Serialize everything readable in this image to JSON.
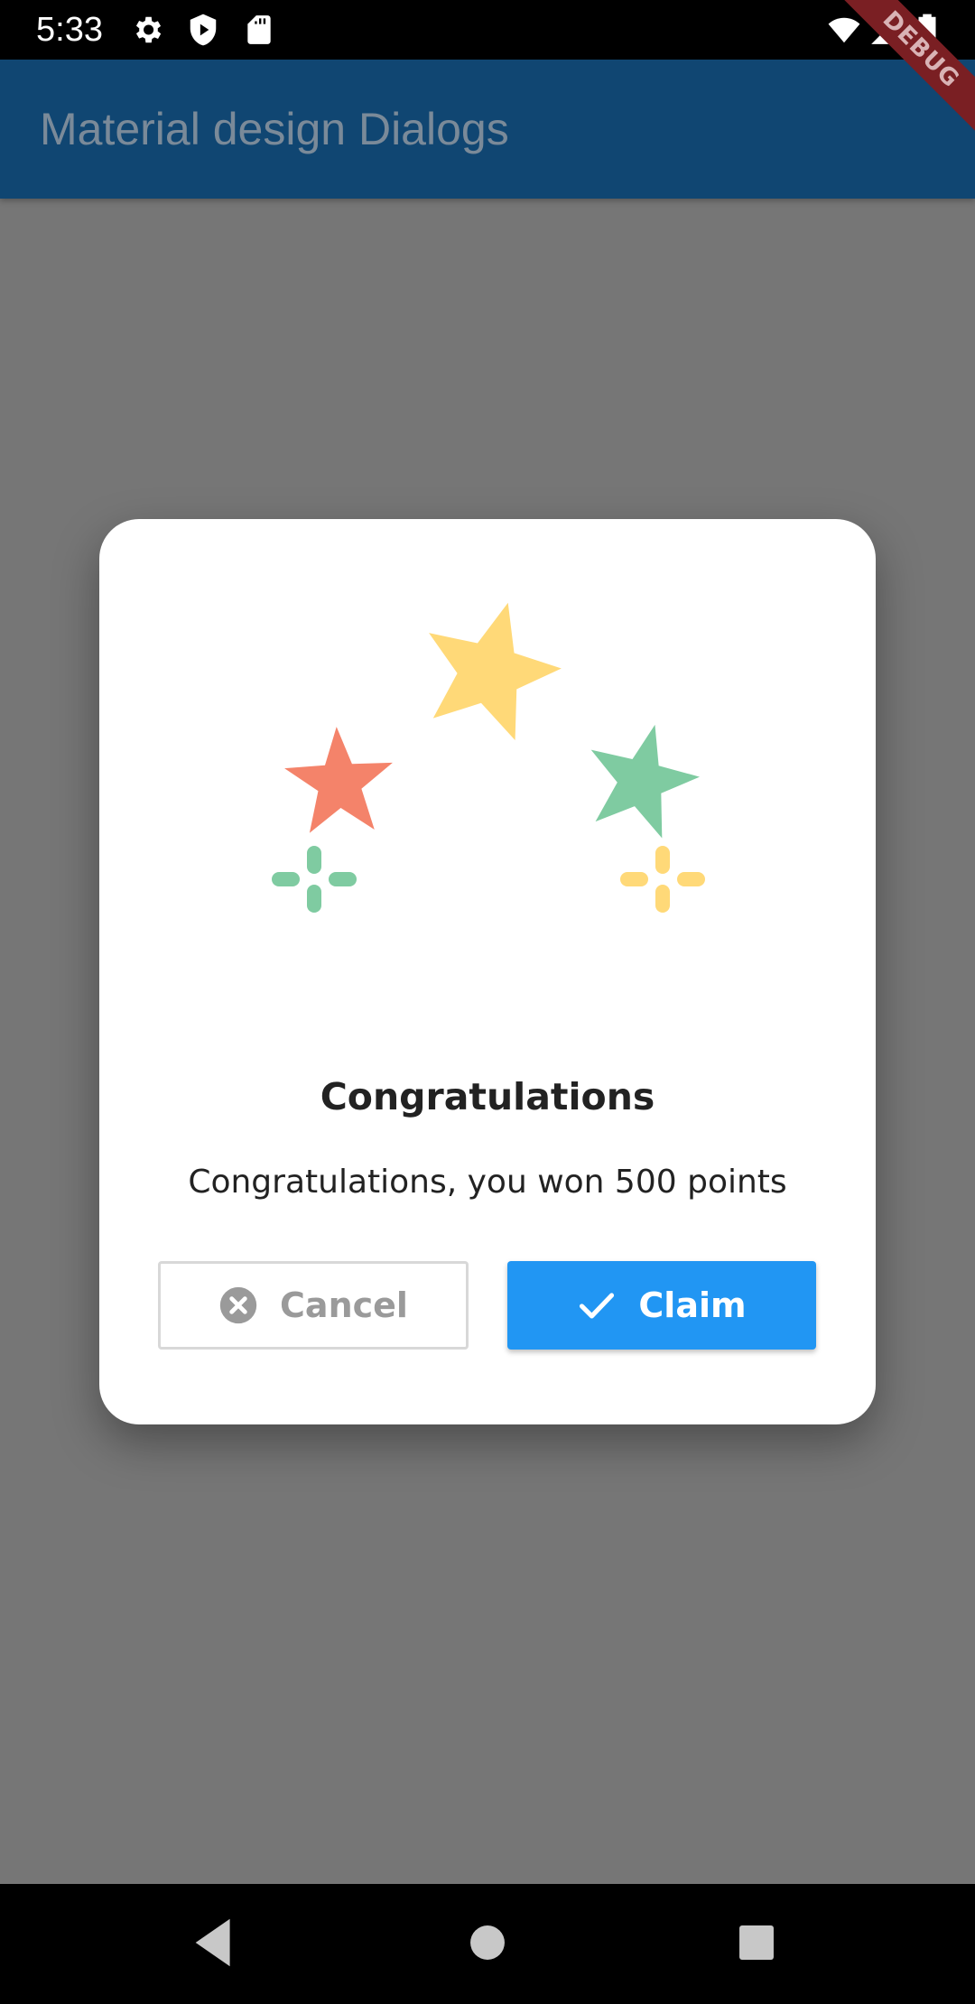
{
  "status_bar": {
    "time": "5:33",
    "left_icons": [
      "settings-icon",
      "play-protect-icon",
      "sd-card-icon"
    ],
    "right_icons": [
      "wifi-icon",
      "signal-icon",
      "battery-icon"
    ]
  },
  "app_bar": {
    "title": "Material design Dialogs",
    "debug_banner": "DEBUG"
  },
  "dialog": {
    "illustration": {
      "stars": [
        {
          "name": "coral-star",
          "color": "#F4836A"
        },
        {
          "name": "yellow-star",
          "color": "#FFD978"
        },
        {
          "name": "green-star",
          "color": "#7FCBA1"
        }
      ],
      "sparkles": [
        {
          "name": "green-sparkle",
          "color": "#7FCBA1"
        },
        {
          "name": "yellow-sparkle",
          "color": "#FFD978"
        }
      ]
    },
    "title": "Congratulations",
    "message": "Congratulations, you won 500 points",
    "cancel_button": {
      "label": "Cancel",
      "icon": "cancel-circle-icon"
    },
    "claim_button": {
      "label": "Claim",
      "icon": "check-icon",
      "color": "#2196F3"
    }
  },
  "nav_bar": {
    "buttons": [
      "back-icon",
      "home-icon",
      "recents-icon"
    ]
  }
}
